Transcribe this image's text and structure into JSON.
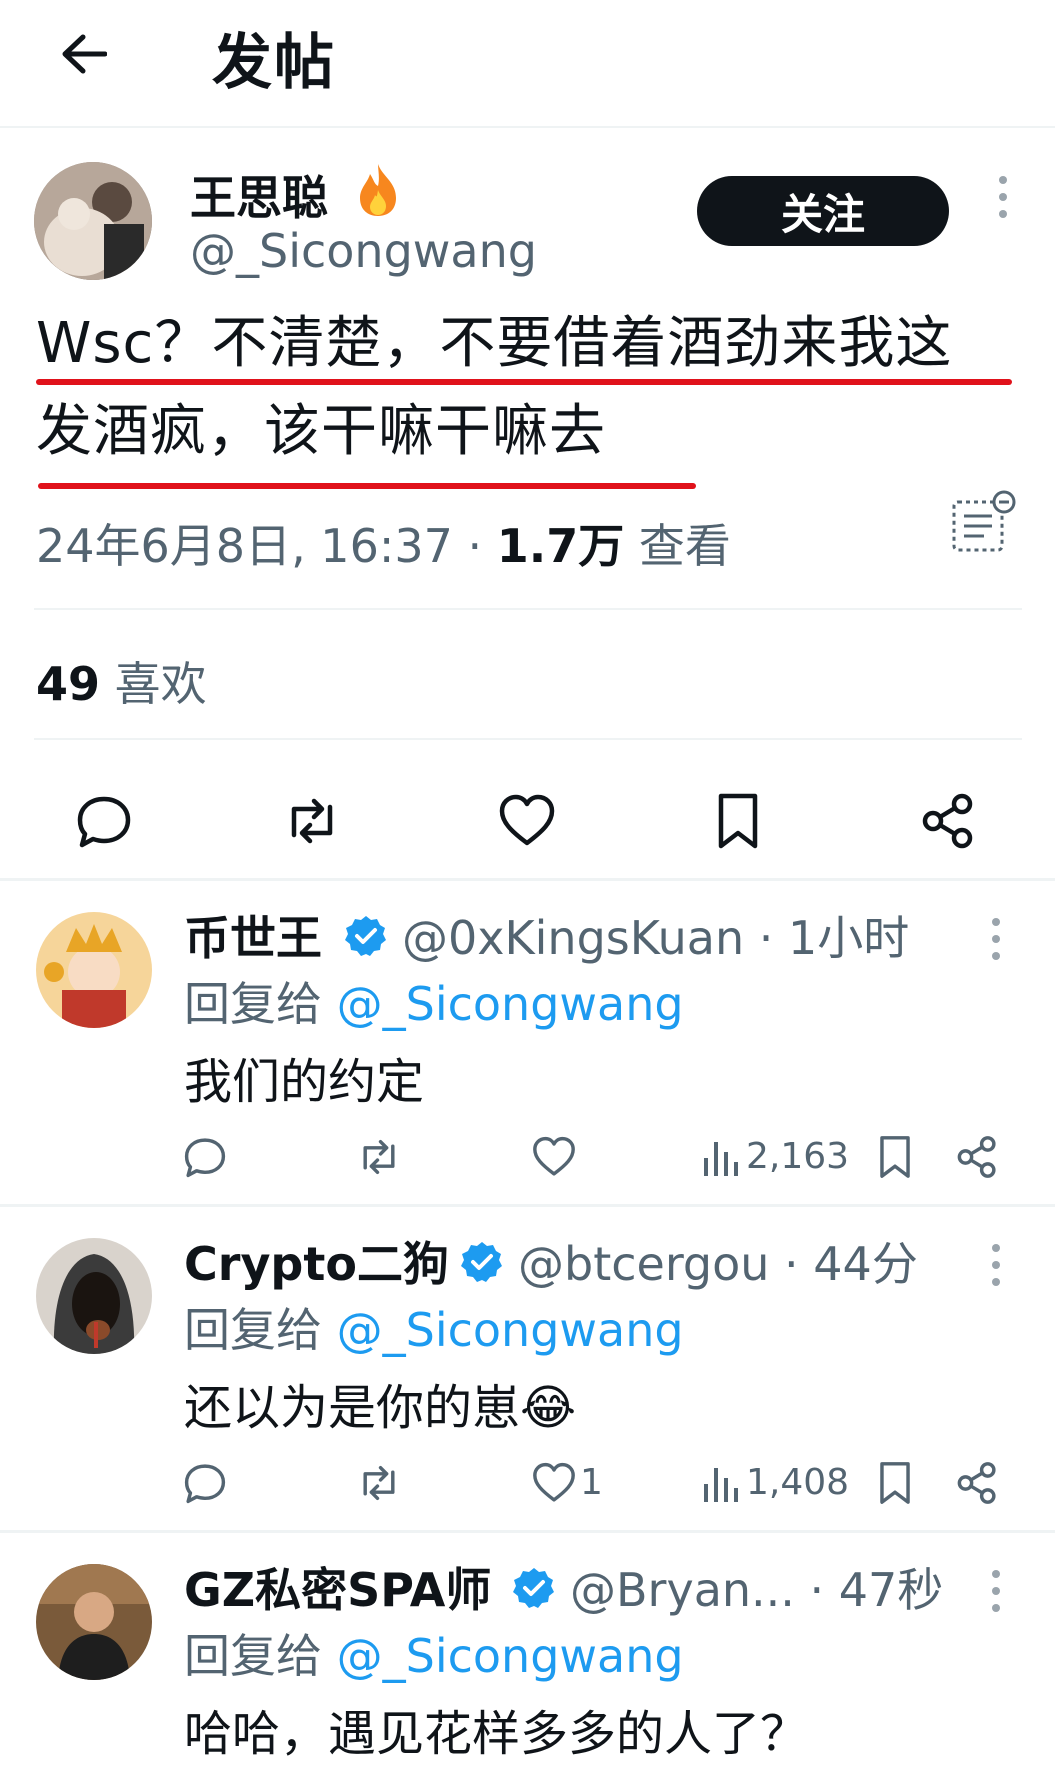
{
  "header": {
    "title": "发帖",
    "back_icon": "arrow-left-icon"
  },
  "post": {
    "author_name": "王思聪",
    "author_handle": "@_Sicongwang",
    "follow_label": "关注",
    "text_line1": "Wsc？不清楚，不要借着酒劲来我这",
    "text_line2": "发酒疯，该干嘛干嘛去",
    "timestamp": "24年6月8日, 16:37 · ",
    "views_count": "1.7万",
    "views_label": " 查看",
    "likes_count": "49",
    "likes_label": " 喜欢",
    "underline_color": "#e0121b"
  },
  "replies": [
    {
      "name": "币世王",
      "handle": "@0xKingsKuan · 1小时",
      "reply_to_label": "回复给 ",
      "reply_to_handle": "@_Sicongwang",
      "text": "我们的约定",
      "like_count": "",
      "views": "2,163"
    },
    {
      "name": "Crypto二狗",
      "handle": "@btcergou · 44分",
      "reply_to_label": "回复给 ",
      "reply_to_handle": "@_Sicongwang",
      "text": "还以为是你的崽😂",
      "like_count": "1",
      "views": "1,408"
    },
    {
      "name": "GZ私密SPA师",
      "handle": "@Bryan...   · 47秒",
      "reply_to_label": "回复给 ",
      "reply_to_handle": "@_Sicongwang",
      "text": "哈哈，遇见花样多多的人了？"
    }
  ],
  "colors": {
    "accent": "#1d9bf0",
    "text": "#0f1419",
    "muted": "#536471",
    "button": "#0f1419"
  }
}
